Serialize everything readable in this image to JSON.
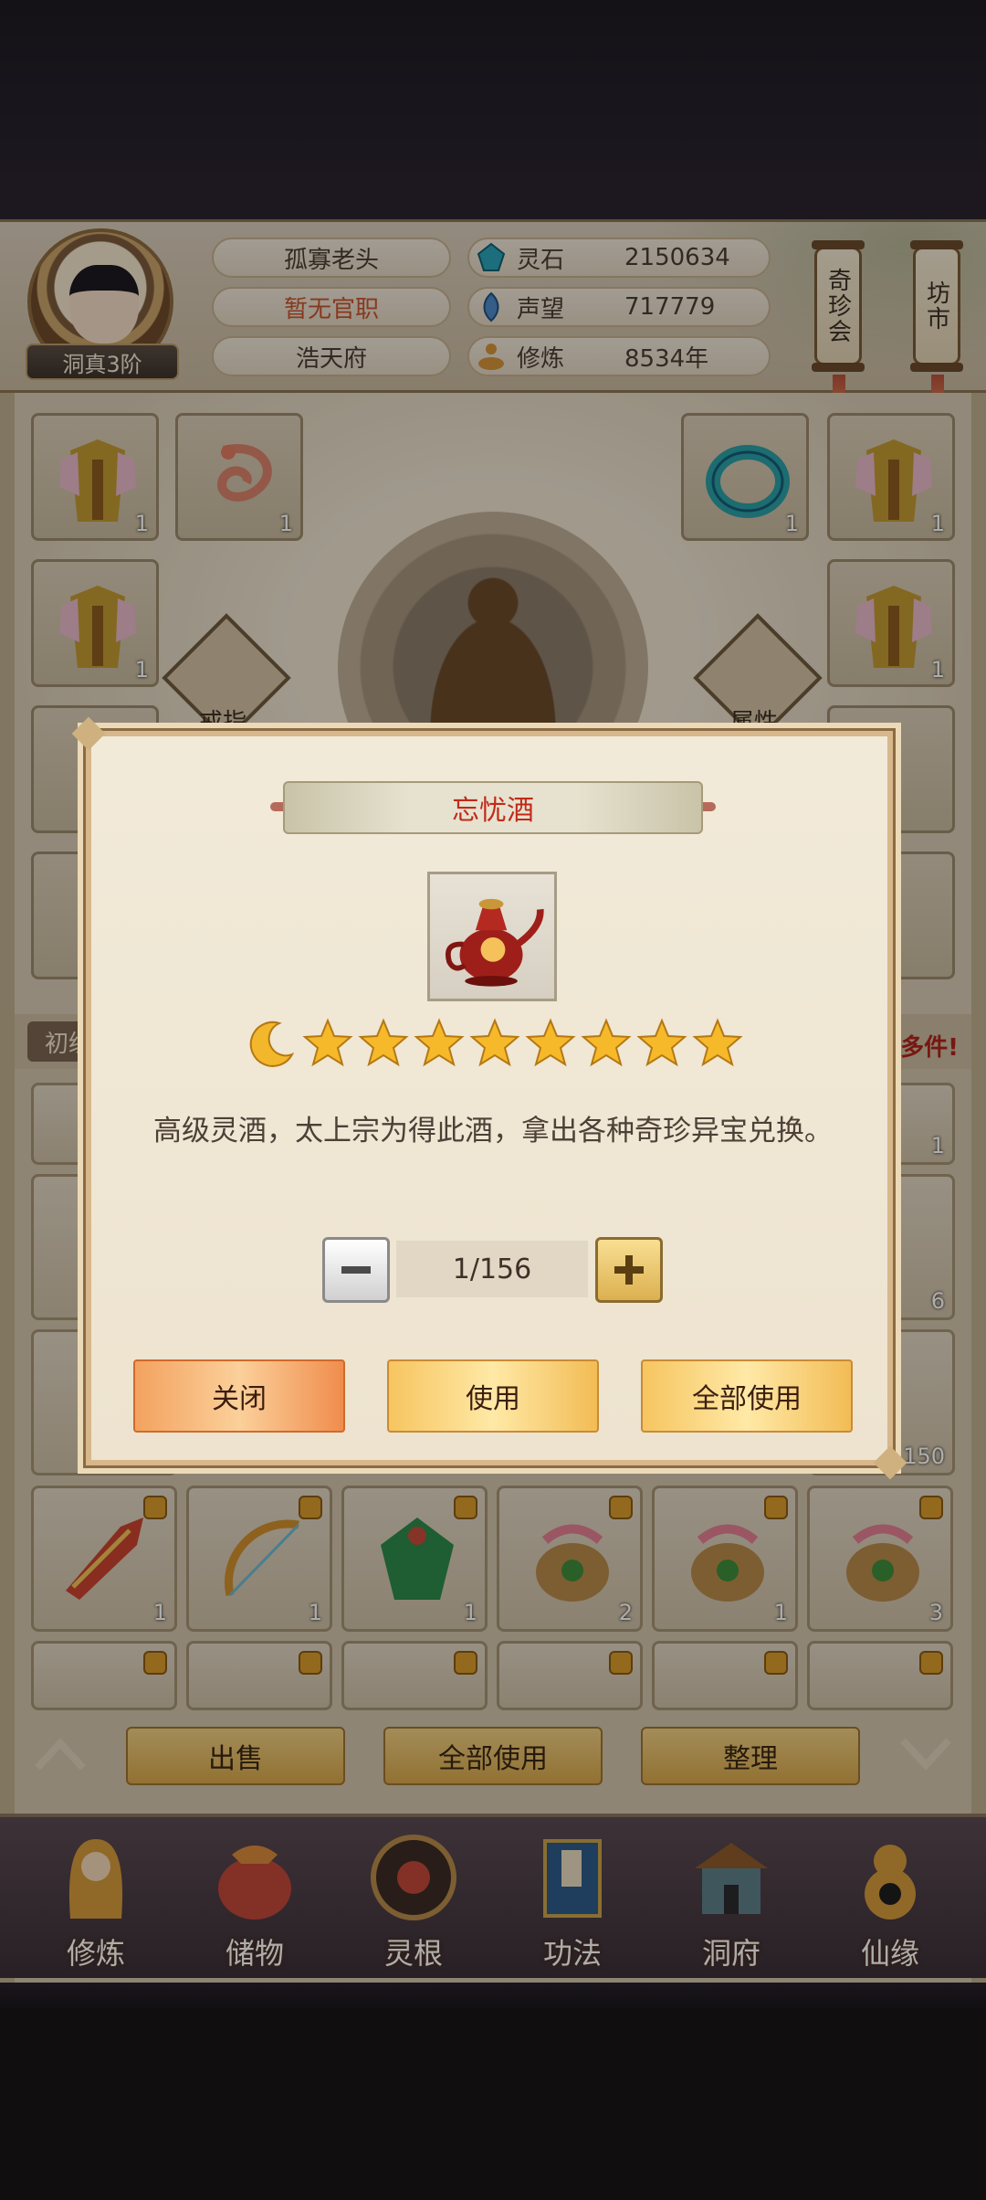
{
  "header": {
    "rank": "洞真3阶",
    "player_name": "孤寡老头",
    "title": "暂无官职",
    "residence": "浩天府",
    "stats": [
      {
        "label": "灵石",
        "value": "2150634",
        "icon": "spirit-stone-icon"
      },
      {
        "label": "声望",
        "value": "717779",
        "icon": "reputation-icon"
      },
      {
        "label": "修炼",
        "value": "8534年",
        "icon": "cultivation-icon"
      }
    ],
    "side_buttons": [
      "奇珍会",
      "坊市"
    ]
  },
  "equipment": {
    "left_column": [
      {
        "count": "1"
      },
      {
        "count": "1"
      }
    ],
    "second_column": [
      {
        "count": "1"
      }
    ],
    "right_column": [
      {
        "count": "1"
      },
      {
        "count": "1"
      },
      {
        "count": "1"
      }
    ],
    "labels": {
      "ring": "戒指",
      "attribute": "属性"
    }
  },
  "bag": {
    "tab_label": "初级",
    "hint": "多件!",
    "visible_counts": [
      "1",
      "6",
      "150"
    ],
    "row_counts": [
      "1",
      "1",
      "1",
      "2",
      "1",
      "3"
    ]
  },
  "actions": {
    "sell": "出售",
    "use_all": "全部使用",
    "organize": "整理"
  },
  "nav": [
    "修炼",
    "储物",
    "灵根",
    "功法",
    "洞府",
    "仙缘"
  ],
  "dialog": {
    "title": "忘忧酒",
    "stars": 8,
    "moon": 1,
    "description": "高级灵酒，太上宗为得此酒，拿出各种奇珍异宝兑换。",
    "quantity": "1/156",
    "buttons": {
      "close": "关闭",
      "use": "使用",
      "use_all": "全部使用"
    }
  },
  "colors": {
    "title_red": "#c22a1a",
    "gold": "#f2bc55",
    "orange": "#f08d4d",
    "hint_red": "#b2231b"
  }
}
